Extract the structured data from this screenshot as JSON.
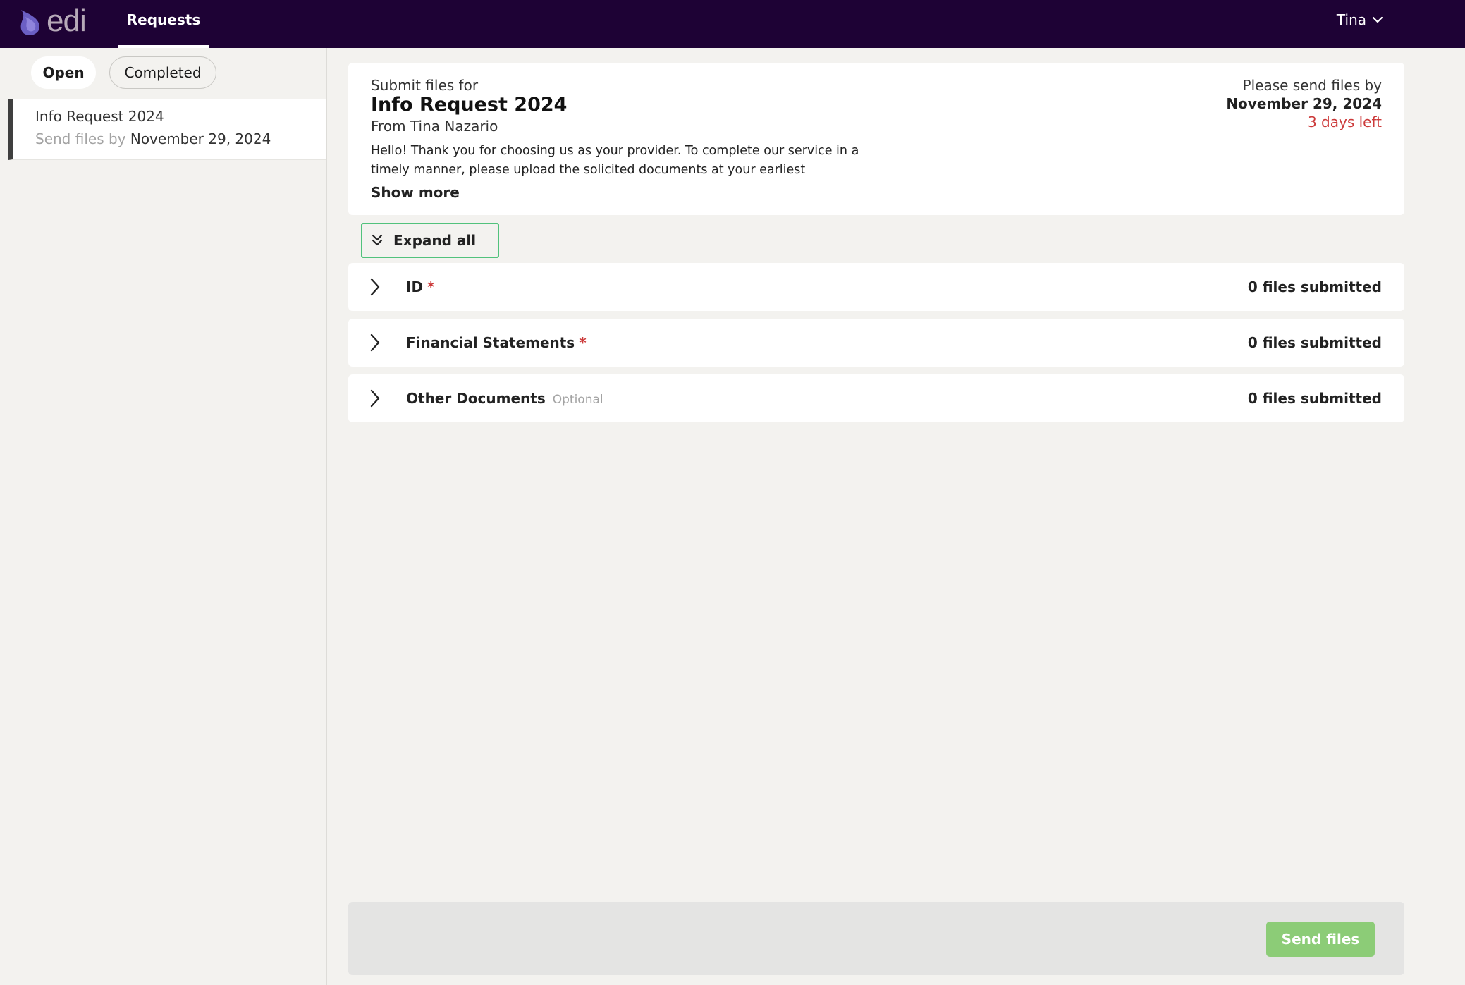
{
  "app": {
    "brand": "edi",
    "nav_tab": "Requests",
    "user": "Tina"
  },
  "sidebar": {
    "tabs": {
      "open": "Open",
      "completed": "Completed"
    },
    "items": [
      {
        "title": "Info Request 2024",
        "send_files_label": "Send files by",
        "date": "November 29, 2024"
      }
    ]
  },
  "request": {
    "kicker": "Submit files for",
    "title": "Info Request 2024",
    "from": "From Tina Nazario",
    "message": "Hello! Thank you for choosing us as your provider. To complete our service in a timely manner, please upload the solicited documents at your earliest",
    "show_more": "Show more",
    "deadline_label": "Please send files by",
    "deadline_date": "November 29, 2024",
    "days_left": "3 days left"
  },
  "expand_all": "Expand all",
  "sections": [
    {
      "name": "ID",
      "required_mark": "*",
      "optional_label": "",
      "count": "0 files submitted"
    },
    {
      "name": "Financial Statements",
      "required_mark": "*",
      "optional_label": "",
      "count": "0 files submitted"
    },
    {
      "name": "Other Documents",
      "required_mark": "",
      "optional_label": "Optional",
      "count": "0 files submitted"
    }
  ],
  "footer": {
    "send_button": "Send files"
  },
  "colors": {
    "topbar": "#1e0235",
    "required": "#cc3a3a",
    "focus_outline": "#51c27c",
    "send_button": "#8ccc77"
  },
  "icons": {
    "logo": "drop-logo-icon",
    "user_menu": "chevron-down-icon",
    "expand_all": "double-chevron-down-icon",
    "section_toggle": "chevron-right-icon"
  }
}
